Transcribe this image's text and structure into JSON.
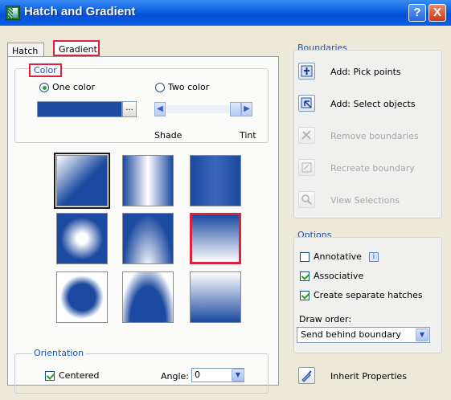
{
  "window": {
    "title": "Hatch and Gradient",
    "help_glyph": "?",
    "close_glyph": "X"
  },
  "tabs": [
    {
      "label": "Hatch"
    },
    {
      "label": "Gradient"
    }
  ],
  "color": {
    "group_label": "Color",
    "one_color_label": "One color",
    "two_color_label": "Two color",
    "selected_mode": "One color",
    "swatch_color": "#1c4aa0",
    "browse_glyph": "...",
    "shade_label": "Shade",
    "tint_label": "Tint"
  },
  "gradient_patterns": {
    "selected_index": 5,
    "highlighted_index": 5,
    "base_color": "#1c4aa0",
    "names": [
      "linear",
      "cylinder",
      "inv-cylinder",
      "spherical",
      "hemispherical",
      "curved",
      "inv-spherical",
      "inv-hemispherical",
      "inv-curved"
    ]
  },
  "orientation": {
    "group_label": "Orientation",
    "centered_label": "Centered",
    "centered_checked": true,
    "angle_label": "Angle:",
    "angle_value": "0"
  },
  "boundaries": {
    "title": "Boundaries",
    "items": [
      {
        "label": "Add: Pick points",
        "enabled": true
      },
      {
        "label": "Add: Select objects",
        "enabled": true
      },
      {
        "label": "Remove boundaries",
        "enabled": false
      },
      {
        "label": "Recreate boundary",
        "enabled": false
      },
      {
        "label": "View Selections",
        "enabled": false
      }
    ]
  },
  "options": {
    "title": "Options",
    "annotative_label": "Annotative",
    "annotative_checked": false,
    "associative_label": "Associative",
    "associative_checked": true,
    "separate_label": "Create separate hatches",
    "separate_checked": true,
    "draw_order_label": "Draw order:",
    "draw_order_value": "Send behind boundary",
    "info_glyph": "i"
  },
  "inherit": {
    "label": "Inherit Properties"
  },
  "colors": {
    "highlight": "#e0203c",
    "title_bar": "#0b5ee0",
    "group_label": "#1550c8"
  }
}
